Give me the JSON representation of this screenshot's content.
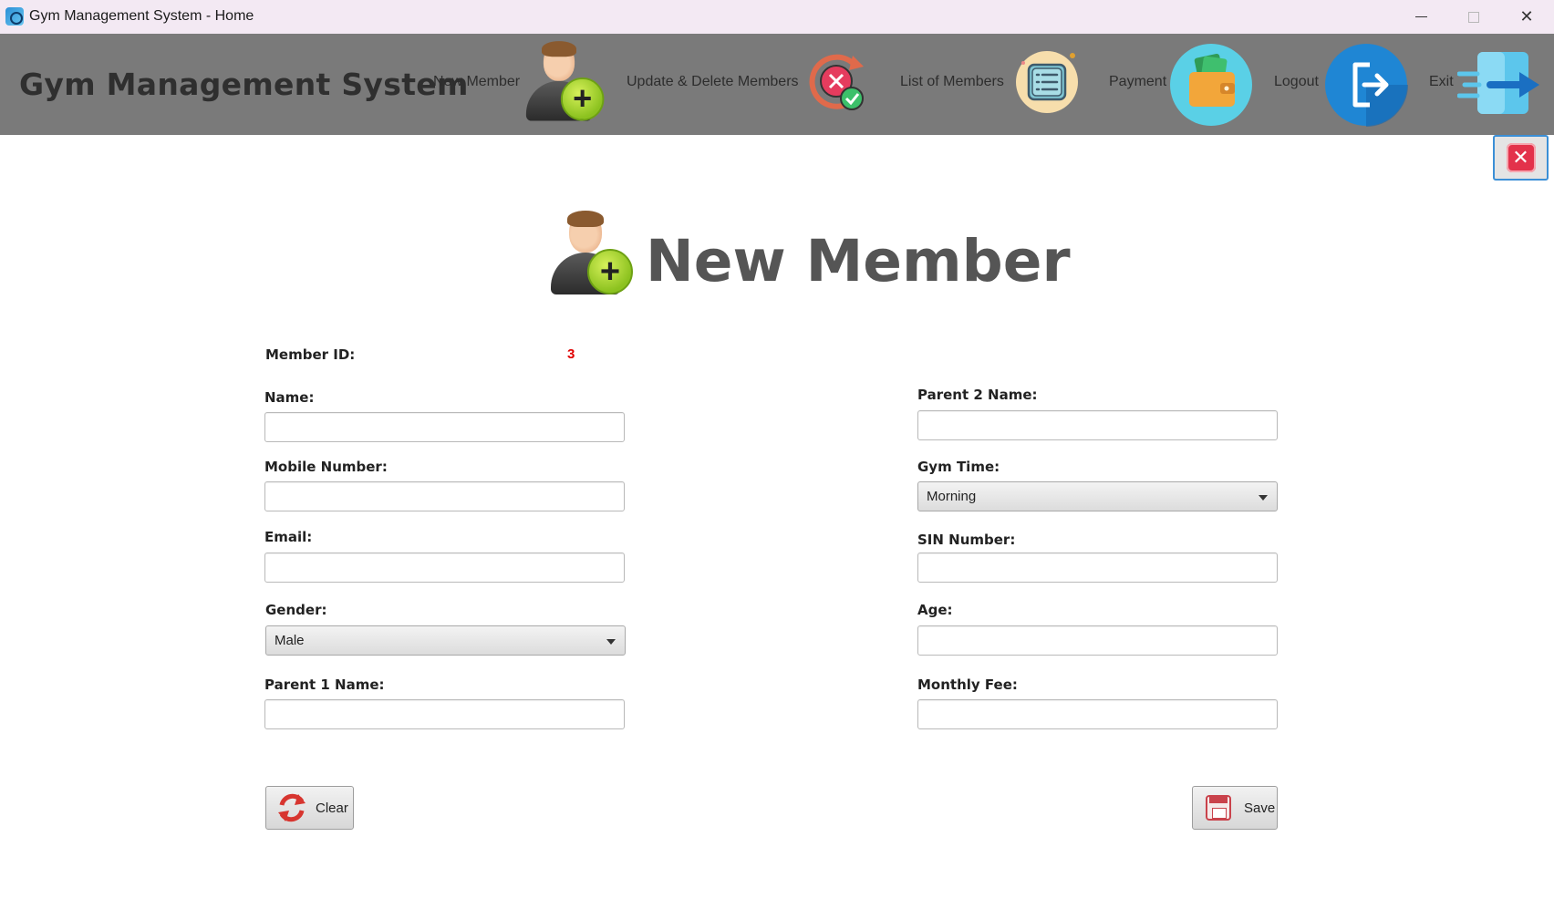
{
  "window": {
    "title": "Gym Management System - Home",
    "minimize_glyph": "",
    "close_glyph": "✕"
  },
  "header": {
    "brand": "Gym Management System",
    "nav": [
      {
        "label": "New Member",
        "icon": "add-user-icon"
      },
      {
        "label": "Update & Delete Members",
        "icon": "update-delete-icon"
      },
      {
        "label": "List of Members",
        "icon": "list-icon"
      },
      {
        "label": "Payment",
        "icon": "wallet-icon"
      },
      {
        "label": "Logout",
        "icon": "logout-icon"
      },
      {
        "label": "Exit",
        "icon": "exit-icon"
      }
    ]
  },
  "panel": {
    "close_glyph": "✕"
  },
  "form": {
    "title": "New Member",
    "member_id_label": "Member ID:",
    "member_id_value": "3",
    "name_label": "Name:",
    "name_value": "",
    "mobile_label": "Mobile Number:",
    "mobile_value": "",
    "email_label": "Email:",
    "email_value": "",
    "gender_label": "Gender:",
    "gender_value": "Male",
    "parent1_label": "Parent 1 Name:",
    "parent1_value": "",
    "parent2_label": "Parent 2 Name:",
    "parent2_value": "",
    "gym_time_label": "Gym Time:",
    "gym_time_value": "Morning",
    "sin_label": "SIN Number:",
    "sin_value": "",
    "age_label": "Age:",
    "age_value": "",
    "monthly_fee_label": "Monthly Fee:",
    "monthly_fee_value": "",
    "clear_label": "Clear",
    "save_label": "Save"
  },
  "colors": {
    "header_bg": "#7a7a7a",
    "member_id_value": "#e00000",
    "titlebar_bg": "#f3e9f3"
  }
}
